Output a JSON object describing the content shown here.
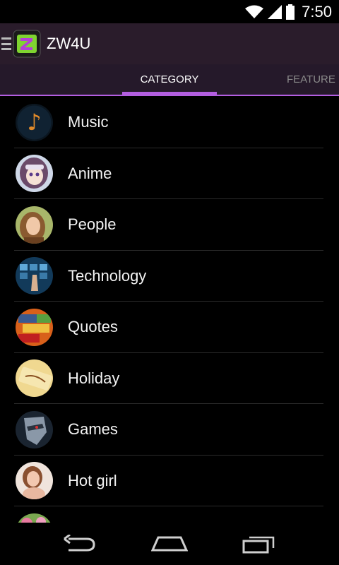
{
  "status_bar": {
    "time": "7:50",
    "icons": [
      "wifi-icon",
      "signal-icon",
      "battery-icon"
    ]
  },
  "action_bar": {
    "title": "ZW4U",
    "icons": [
      "menu-icon",
      "app-logo"
    ]
  },
  "tabs": [
    {
      "label": "CATEGORY",
      "selected": true
    },
    {
      "label": "FEATURE",
      "selected": false
    }
  ],
  "categories": [
    {
      "label": "Music",
      "icon": "treble-clef"
    },
    {
      "label": "Anime",
      "icon": "anime-girl"
    },
    {
      "label": "People",
      "icon": "portrait"
    },
    {
      "label": "Technology",
      "icon": "touch-screen"
    },
    {
      "label": "Quotes",
      "icon": "love-notes"
    },
    {
      "label": "Holiday",
      "icon": "holiday-sign"
    },
    {
      "label": "Games",
      "icon": "game-character"
    },
    {
      "label": "Hot girl",
      "icon": "portrait-girl"
    },
    {
      "label": "",
      "icon": "flowers"
    }
  ],
  "nav_bar": {
    "icons": [
      "back-icon",
      "home-icon",
      "recent-apps-icon"
    ]
  },
  "colors": {
    "accent": "#b35ee0",
    "action_bar": "#2a1c2b",
    "tab_bar": "#25192a"
  }
}
